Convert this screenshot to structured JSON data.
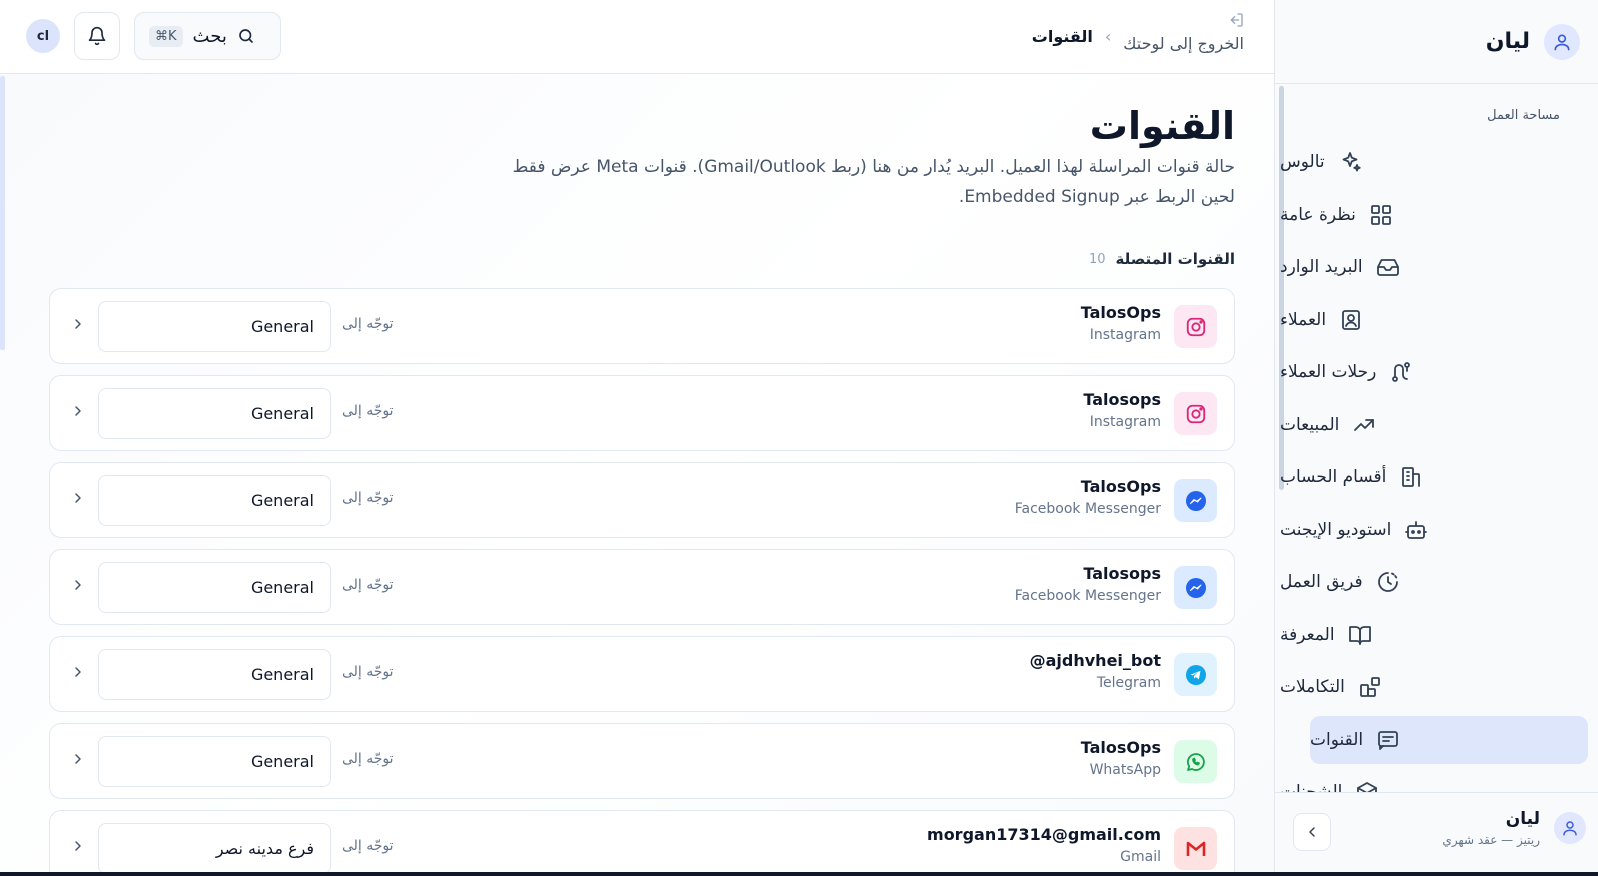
{
  "sidebar": {
    "org_name": "ليان",
    "section_label": "مساحة العمل",
    "items": [
      {
        "label": "تالوس",
        "icon": "sparkles-icon"
      },
      {
        "label": "نظرة عامة",
        "icon": "grid-icon"
      },
      {
        "label": "البريد الوارد",
        "icon": "inbox-icon"
      },
      {
        "label": "العملاء",
        "icon": "contact-icon"
      },
      {
        "label": "رحلات العملاء",
        "icon": "route-icon"
      },
      {
        "label": "المبيعات",
        "icon": "trend-up-icon"
      },
      {
        "label": "أقسام الحساب",
        "icon": "building-icon"
      },
      {
        "label": "استوديو الإيجنت",
        "icon": "bot-icon"
      },
      {
        "label": "فريق العمل",
        "icon": "clock-icon"
      },
      {
        "label": "المعرفة",
        "icon": "book-icon"
      },
      {
        "label": "التكاملات",
        "icon": "blocks-icon"
      },
      {
        "label": "القنوات",
        "icon": "message-icon",
        "active": true
      },
      {
        "label": "الشحنات",
        "icon": "package-icon"
      }
    ],
    "footer": {
      "name": "ليان",
      "plan": "ريتيز — عقد شهري"
    }
  },
  "topbar": {
    "avatar_initials": "cl",
    "search_label": "بحث",
    "search_shortcut": "⌘K",
    "breadcrumb_exit": "الخروج إلى لوحتك",
    "breadcrumb_current": "القنوات"
  },
  "main": {
    "title": "القنوات",
    "description": "حالة قنوات المراسلة لهذا العميل. البريد يُدار من هنا (ربط Gmail/Outlook). قنوات Meta عرض فقط لحين الربط عبر Embedded Signup.",
    "section_title": "القنوات المتصلة",
    "section_count": "10",
    "route_label": "توجّه إلى",
    "channels": [
      {
        "name": "TalosOps",
        "type": "Instagram",
        "department": "General",
        "icon": "instagram-icon",
        "color": "#db2777",
        "bg": "#fce7f3"
      },
      {
        "name": "Talosops",
        "type": "Instagram",
        "department": "General",
        "icon": "instagram-icon",
        "color": "#db2777",
        "bg": "#fce7f3"
      },
      {
        "name": "TalosOps",
        "type": "Facebook Messenger",
        "department": "General",
        "icon": "messenger-icon",
        "color": "#2563eb",
        "bg": "#dbeafe"
      },
      {
        "name": "Talosops",
        "type": "Facebook Messenger",
        "department": "General",
        "icon": "messenger-icon",
        "color": "#2563eb",
        "bg": "#dbeafe"
      },
      {
        "name": "@ajdhvhei_bot",
        "type": "Telegram",
        "department": "General",
        "icon": "telegram-icon",
        "color": "#0ea5e9",
        "bg": "#e0f2fe"
      },
      {
        "name": "TalosOps",
        "type": "WhatsApp",
        "department": "General",
        "icon": "whatsapp-icon",
        "color": "#16a34a",
        "bg": "#dcfce7"
      },
      {
        "name": "morgan17314@gmail.com",
        "type": "Gmail",
        "department": "فرع مدينه نصر",
        "icon": "gmail-icon",
        "color": "#dc2626",
        "bg": "#fee2e2"
      }
    ]
  }
}
